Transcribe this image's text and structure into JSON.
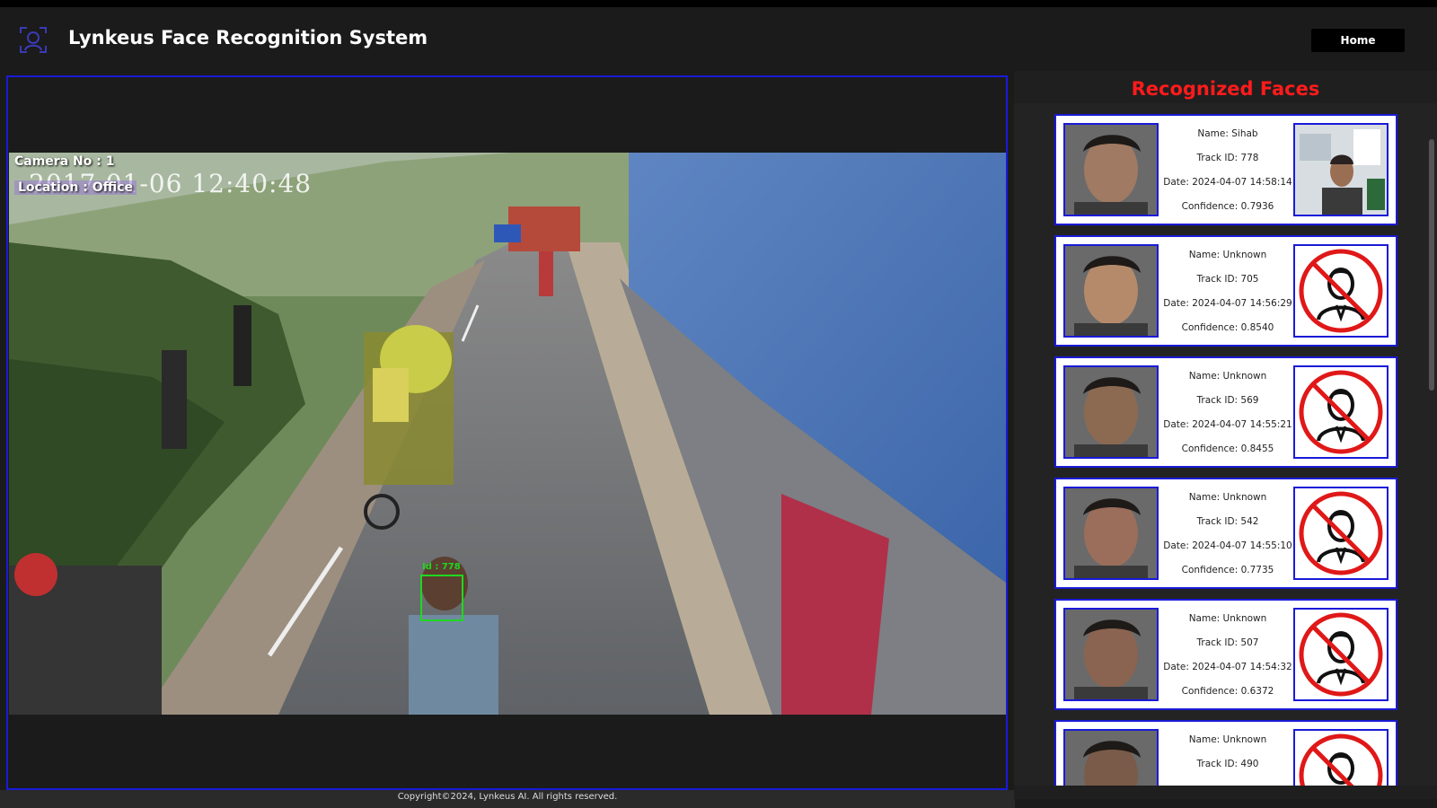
{
  "header": {
    "title": "Lynkeus Face Recognition System",
    "home_label": "Home",
    "logo_icon": "face-scan-icon"
  },
  "video": {
    "camera_label": "Camera No : 1",
    "location_label": "Location : Office",
    "timestamp": "2017-01-06 12:40:48",
    "track_label": "Id : 778",
    "box_color": "#1fd81f"
  },
  "sidebar": {
    "title": "Recognized Faces",
    "title_color": "#ff1b1b",
    "cards": [
      {
        "name": "Name: Sihab",
        "track": "Track ID: 778",
        "date": "Date: 2024-04-07 14:58:14",
        "confidence": "Confidence: 0.7936",
        "known": true
      },
      {
        "name": "Name: Unknown",
        "track": "Track ID: 705",
        "date": "Date: 2024-04-07 14:56:29",
        "confidence": "Confidence: 0.8540",
        "known": false
      },
      {
        "name": "Name: Unknown",
        "track": "Track ID: 569",
        "date": "Date: 2024-04-07 14:55:21",
        "confidence": "Confidence: 0.8455",
        "known": false
      },
      {
        "name": "Name: Unknown",
        "track": "Track ID: 542",
        "date": "Date: 2024-04-07 14:55:10",
        "confidence": "Confidence: 0.7735",
        "known": false
      },
      {
        "name": "Name: Unknown",
        "track": "Track ID: 507",
        "date": "Date: 2024-04-07 14:54:32",
        "confidence": "Confidence: 0.6372",
        "known": false
      },
      {
        "name": "Name: Unknown",
        "track": "Track ID: 490",
        "date": "",
        "confidence": "",
        "known": false
      }
    ]
  },
  "footer": {
    "copyright": "Copyright©2024, Lynkeus AI. All rights reserved."
  },
  "colors": {
    "accent_border": "#1a1ad8",
    "background": "#1b1b1b"
  }
}
